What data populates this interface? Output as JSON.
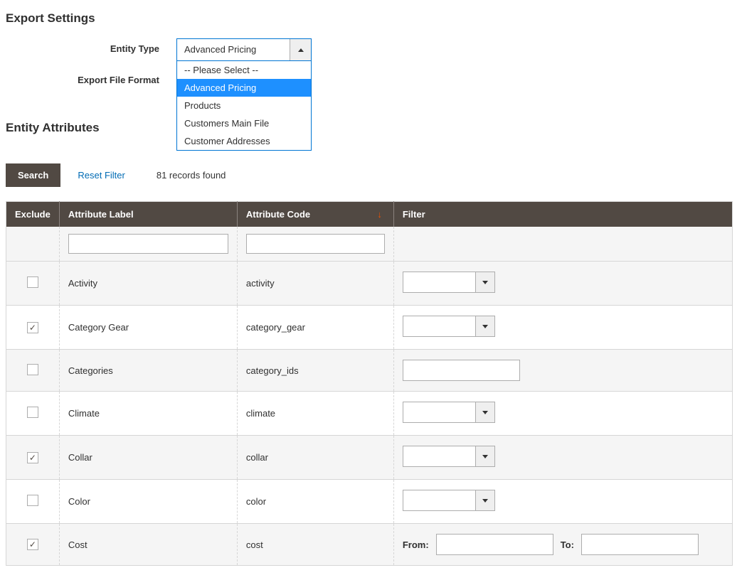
{
  "sections": {
    "export_settings": "Export Settings",
    "entity_attributes": "Entity Attributes"
  },
  "form": {
    "entity_type_label": "Entity Type",
    "file_format_label": "Export File Format",
    "entity_select": {
      "value": "Advanced Pricing",
      "options": [
        "-- Please Select --",
        "Advanced Pricing",
        "Products",
        "Customers Main File",
        "Customer Addresses"
      ],
      "selected_index": 1
    }
  },
  "toolbar": {
    "search": "Search",
    "reset": "Reset Filter",
    "records": "81 records found"
  },
  "grid": {
    "headers": {
      "exclude": "Exclude",
      "label": "Attribute Label",
      "code": "Attribute Code",
      "filter": "Filter"
    },
    "range": {
      "from": "From:",
      "to": "To:"
    },
    "rows": [
      {
        "excluded": false,
        "label": "Activity",
        "code": "activity",
        "filter_type": "select"
      },
      {
        "excluded": true,
        "label": "Category Gear",
        "code": "category_gear",
        "filter_type": "select"
      },
      {
        "excluded": false,
        "label": "Categories",
        "code": "category_ids",
        "filter_type": "text"
      },
      {
        "excluded": false,
        "label": "Climate",
        "code": "climate",
        "filter_type": "select"
      },
      {
        "excluded": true,
        "label": "Collar",
        "code": "collar",
        "filter_type": "select"
      },
      {
        "excluded": false,
        "label": "Color",
        "code": "color",
        "filter_type": "select"
      },
      {
        "excluded": true,
        "label": "Cost",
        "code": "cost",
        "filter_type": "range"
      }
    ]
  }
}
